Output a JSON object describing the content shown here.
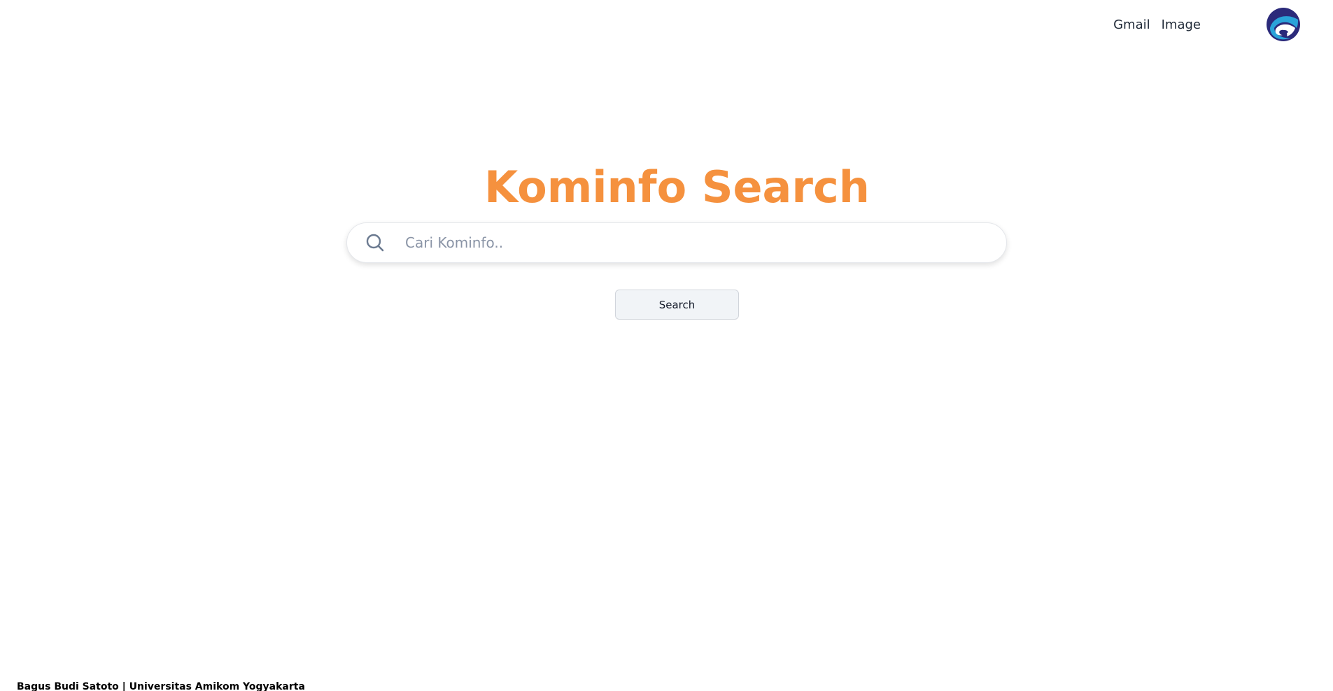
{
  "nav": {
    "gmail_label": "Gmail",
    "image_label": "Image",
    "logo_icon": "kominfo-logo-icon"
  },
  "hero": {
    "title": "Kominfo Search"
  },
  "search": {
    "icon": "search-icon",
    "placeholder": "Cari Kominfo..",
    "value": "",
    "button_label": "Search"
  },
  "footer": {
    "text": "Bagus Budi Satoto | Universitas Amikom Yogyakarta"
  },
  "colors": {
    "accent": "#f5913e",
    "logo_dark": "#2b2a7a",
    "logo_light": "#2aa3d9"
  }
}
